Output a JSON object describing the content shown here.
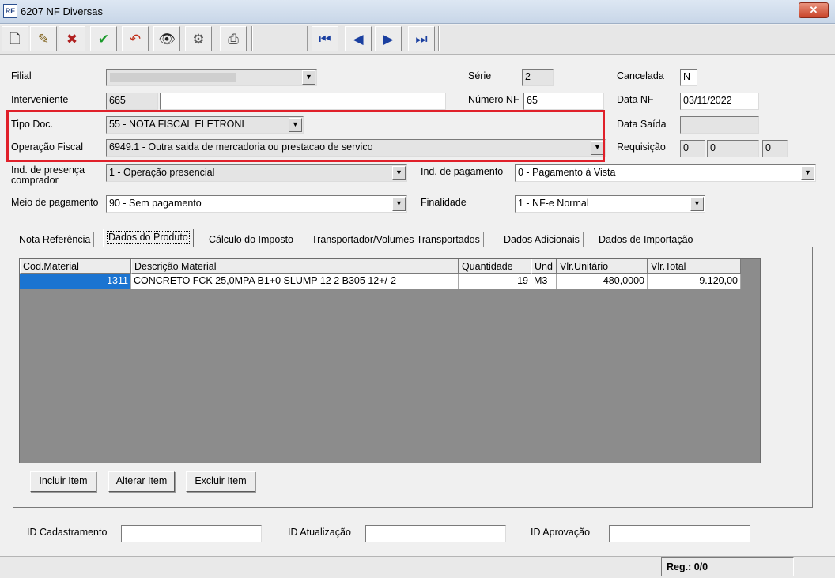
{
  "window": {
    "title": "6207 NF Diversas",
    "icon_text": "RE",
    "close_label": "✕"
  },
  "toolbar": {
    "buttons": [
      {
        "name": "new-doc-icon",
        "glyph": "🗋"
      },
      {
        "name": "edit-icon",
        "glyph": "✎"
      },
      {
        "name": "delete-icon",
        "glyph": "✖"
      },
      {
        "name": "confirm-check-icon",
        "glyph": "✔"
      },
      {
        "name": "undo-icon",
        "glyph": "↶"
      },
      {
        "name": "binoculars-search-icon",
        "glyph": "👁"
      },
      {
        "name": "tools-icon",
        "glyph": "⚙"
      },
      {
        "name": "printer-icon",
        "glyph": "⎙"
      },
      {
        "name": "first-record-icon",
        "glyph": "⏮"
      },
      {
        "name": "previous-record-icon",
        "glyph": "◀"
      },
      {
        "name": "next-record-icon",
        "glyph": "▶"
      },
      {
        "name": "last-record-icon",
        "glyph": "⏭"
      }
    ]
  },
  "form": {
    "filial_label": "Filial",
    "filial_value": "",
    "serie_label": "Série",
    "serie_value": "2",
    "cancelada_label": "Cancelada",
    "cancelada_value": "N",
    "interveniente_label": "Interveniente",
    "interveniente_code": "665",
    "interveniente_name": "",
    "numero_nf_label": "Número NF",
    "numero_nf_value": "65",
    "data_nf_label": "Data NF",
    "data_nf_value": "03/11/2022",
    "tipo_doc_label": "Tipo Doc.",
    "tipo_doc_value": "55 - NOTA FISCAL ELETRONI",
    "data_saida_label": "Data Saída",
    "data_saida_value": "",
    "operacao_fiscal_label": "Operação Fiscal",
    "operacao_fiscal_value": "6949.1 - Outra saida de mercadoria ou prestacao de servico",
    "requisicao_label": "Requisição",
    "requisicao_1": "0",
    "requisicao_2": "0",
    "requisicao_3": "0",
    "ind_presenca_label_1": "Ind. de presença",
    "ind_presenca_label_2": "comprador",
    "ind_presenca_value": "1 - Operação presencial",
    "ind_pagamento_label": "Ind. de pagamento",
    "ind_pagamento_value": "0 - Pagamento à Vista",
    "meio_pagamento_label": "Meio de pagamento",
    "meio_pagamento_value": "90 - Sem pagamento",
    "finalidade_label": "Finalidade",
    "finalidade_value": "1 - NF-e Normal"
  },
  "tabs": [
    {
      "label": "Nota Referência",
      "active": false
    },
    {
      "label": "Dados do Produto",
      "active": true
    },
    {
      "label": "Cálculo do Imposto",
      "active": false
    },
    {
      "label": "Transportador/Volumes Transportados",
      "active": false
    },
    {
      "label": "Dados Adicionais",
      "active": false
    },
    {
      "label": "Dados de Importação",
      "active": false
    }
  ],
  "grid": {
    "columns": [
      "Cod.Material",
      "Descrição Material",
      "Quantidade",
      "Und",
      "Vlr.Unitário",
      "Vlr.Total"
    ],
    "rows": [
      [
        "1311",
        "CONCRETO FCK 25,0MPA B1+0 SLUMP 12 2 B305 12+/-2",
        "19",
        "M3",
        "480,0000",
        "9.120,00"
      ]
    ]
  },
  "item_buttons": {
    "incluir": "Incluir Item",
    "alterar": "Alterar Item",
    "excluir": "Excluir Item"
  },
  "audit": {
    "cadastramento_label": "ID Cadastramento",
    "cadastramento_value": "",
    "atualizacao_label": "ID Atualização",
    "atualizacao_value": "",
    "aprovacao_label": "ID Aprovação",
    "aprovacao_value": ""
  },
  "status": {
    "reg_text": "Reg.: 0/0"
  },
  "colors": {
    "highlight": "#e0202a",
    "selection": "#1b74d1",
    "grid_background": "#8c8c8c"
  }
}
